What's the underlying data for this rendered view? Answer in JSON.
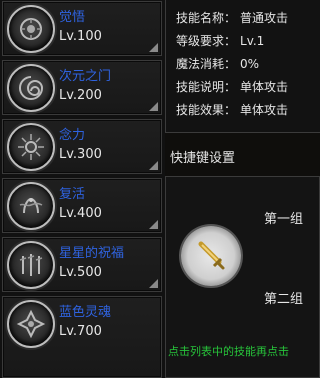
{
  "skills": [
    {
      "name": "觉悟",
      "level": "Lv.100",
      "icon": "awareness-icon"
    },
    {
      "name": "次元之门",
      "level": "Lv.200",
      "icon": "dimension-gate-icon"
    },
    {
      "name": "念力",
      "level": "Lv.300",
      "icon": "telekinesis-icon"
    },
    {
      "name": "复活",
      "level": "Lv.400",
      "icon": "revive-icon"
    },
    {
      "name": "星星的祝福",
      "level": "Lv.500",
      "icon": "star-blessing-icon"
    },
    {
      "name": "蓝色灵魂",
      "level": "Lv.700",
      "icon": "blue-soul-icon"
    }
  ],
  "info": {
    "name_label": "技能名称：",
    "name_value": "普通攻击",
    "req_label": "等级要求：",
    "req_value": "Lv.1",
    "mana_label": "魔法消耗：",
    "mana_value": "0%",
    "desc_label": "技能说明：",
    "desc_value": "单体攻击",
    "effect_label": "技能效果：",
    "effect_value": "单体攻击"
  },
  "shortcut": {
    "title": "快捷键设置",
    "group1": "第一组",
    "group2": "第二组",
    "slot_icon": "sword-icon",
    "hint": "点击列表中的技能再点击"
  },
  "colors": {
    "skill_name": "#2f63e0",
    "hint": "#27c43a"
  }
}
